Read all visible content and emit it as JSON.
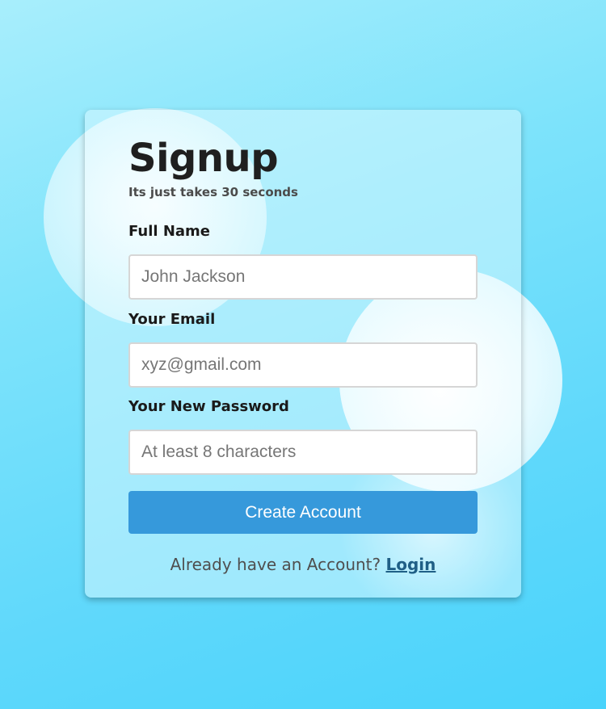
{
  "signup": {
    "title": "Signup",
    "subtitle": "Its just takes 30 seconds",
    "fields": {
      "full_name": {
        "label": "Full Name",
        "value": "",
        "placeholder": "John Jackson"
      },
      "email": {
        "label": "Your Email",
        "value": "",
        "placeholder": "xyz@gmail.com"
      },
      "password": {
        "label": "Your New Password",
        "value": "",
        "placeholder": "At least 8 characters"
      }
    },
    "submit_label": "Create Account",
    "footer_text": "Already have an Account?",
    "login_link": "Login"
  },
  "colors": {
    "button": "#3699db",
    "link": "#1f5f86",
    "background": "#5fd8fb"
  }
}
